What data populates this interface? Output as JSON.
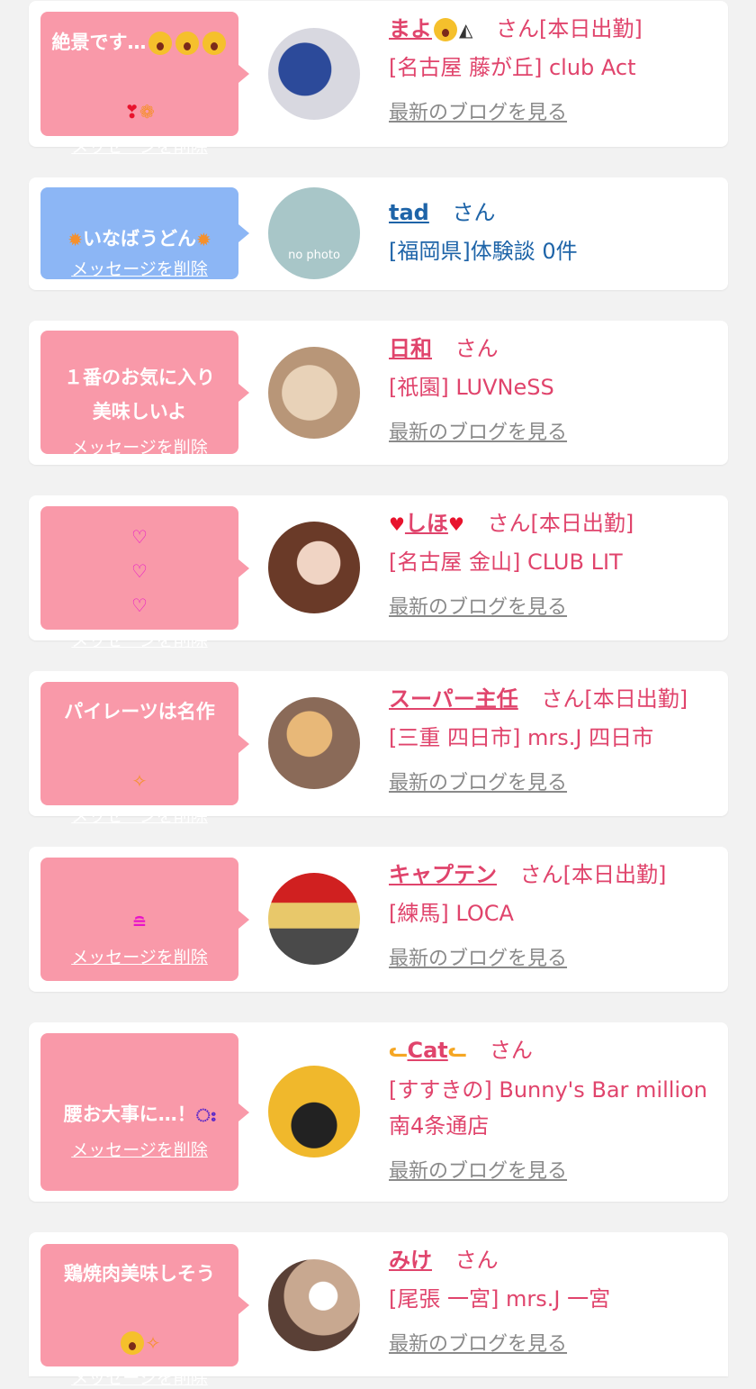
{
  "colors": {
    "bubble_pink": "#f999a9",
    "bubble_blue": "#8cb6f5",
    "name_pink": "#e0446c",
    "name_blue": "#1e64a8",
    "link_gray": "#8a8a8a"
  },
  "delete_label": "メッセージを削除",
  "blog_label": "最新のブログを見る",
  "suffix_san": "さん",
  "items": [
    {
      "message": "絶景です…",
      "message_icons": [
        "drooling-face-icon",
        "drooling-face-icon",
        "drooling-face-icon"
      ],
      "message_line2_icons": [
        "hearts-icon",
        "candy-icon"
      ],
      "name": "まよ",
      "name_icons": [
        "drooling-face-icon",
        "onigiri-icon"
      ],
      "suffix": "さん[本日出勤]",
      "shop": "[名古屋 藤が丘] club Act",
      "shop2": "",
      "blog": true,
      "style": "pink"
    },
    {
      "message": "いなばうどん",
      "message_icons": [
        "sun-icon",
        "sun-icon"
      ],
      "name": "tad",
      "suffix": "さん",
      "shop": "[福岡県]体験談 0件",
      "shop2": "",
      "avatar_text": "no photo",
      "blog": false,
      "style": "blue"
    },
    {
      "message": "１番のお気に入り\n美味しいよ",
      "message_icons": [
        "smile-face-icon"
      ],
      "name": "日和",
      "suffix": "さん",
      "shop": "[祇園] LUVNeSS",
      "shop2": "",
      "blog": true,
      "style": "pink"
    },
    {
      "message": "",
      "message_icons": [
        "heart-eyes-icon",
        "heart-eyes-icon",
        "heart-eyes-icon"
      ],
      "name": "しほ",
      "name_icons": [
        "heart-arrow-icon",
        "heart-arrow-icon"
      ],
      "suffix": "さん[本日出勤]",
      "shop": "[名古屋 金山] CLUB LIT",
      "shop2": "",
      "blog": true,
      "style": "pink"
    },
    {
      "message": "パイレーツは名作",
      "message_icons": [
        "sparkle-icon"
      ],
      "name": "スーパー主任",
      "suffix": "さん[本日出勤]",
      "shop": "[三重 四日市] mrs.J 四日市",
      "shop2": "",
      "blog": true,
      "style": "pink"
    },
    {
      "message": "",
      "message_icons": [
        "smile-face-icon"
      ],
      "name": "キャプテン",
      "suffix": "さん[本日出勤]",
      "shop": "[練馬] LOCA",
      "shop2": "",
      "blog": true,
      "style": "pink"
    },
    {
      "message": "腰お大事に…！",
      "message_icons": [
        "crying-face-icon"
      ],
      "name": "Cat",
      "name_icons": [
        "cat-face-icon",
        "cat-face-icon"
      ],
      "suffix": "さん",
      "shop": "[すすきの] Bunny's Bar million",
      "shop2": "南4条通店",
      "blog": true,
      "style": "pink"
    },
    {
      "message": "鶏焼肉美味しそう",
      "message_icons": [
        "drooling-face-icon",
        "sparkle-icon"
      ],
      "name": "みけ",
      "suffix": "さん",
      "shop": "[尾張 一宮] mrs.J 一宮",
      "shop2": "",
      "blog": true,
      "style": "pink"
    }
  ]
}
